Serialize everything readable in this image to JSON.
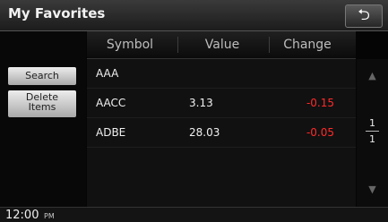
{
  "window": {
    "title": "My Favorites",
    "back_icon": "return-arrow-icon"
  },
  "table": {
    "columns": [
      "Symbol",
      "Value",
      "Change"
    ],
    "rows": [
      {
        "symbol": "AAA",
        "value": "",
        "change": ""
      },
      {
        "symbol": "AACC",
        "value": "3.13",
        "change": "-0.15"
      },
      {
        "symbol": "ADBE",
        "value": "28.03",
        "change": "-0.05"
      }
    ]
  },
  "sidebar": {
    "search_label": "Search",
    "delete_label": "Delete\nItems"
  },
  "pager": {
    "current": "1",
    "total": "1"
  },
  "status": {
    "time": "12:00",
    "ampm": "PM"
  },
  "colors": {
    "negative": "#ff2a2a"
  }
}
